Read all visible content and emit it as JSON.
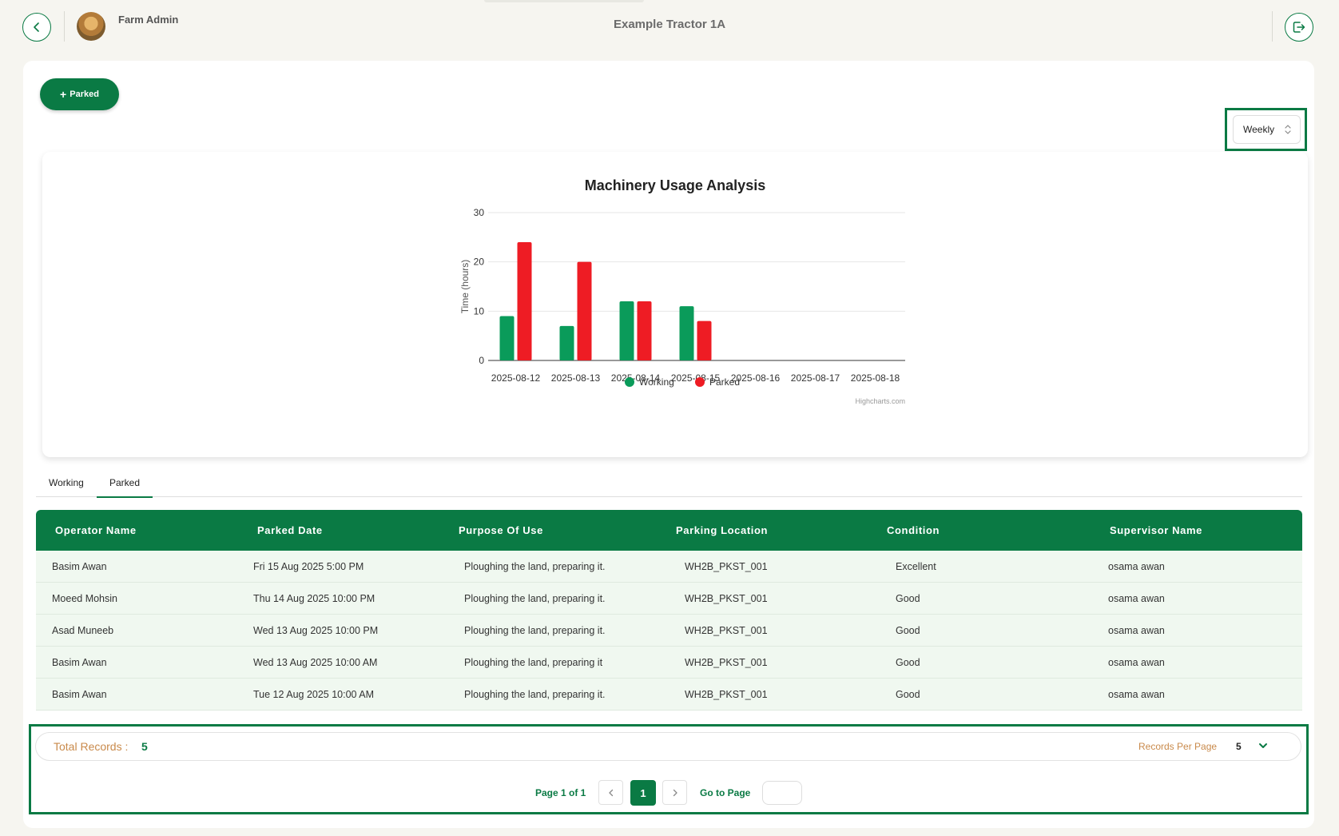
{
  "header": {
    "user_name": "Farm Admin",
    "page_title": "Example Tractor 1A"
  },
  "toolbar": {
    "add_label": "Parked",
    "period_value": "Weekly"
  },
  "chart_data": {
    "type": "bar",
    "title": "Machinery Usage Analysis",
    "ylabel": "Time (hours)",
    "xlabel": "",
    "ylim": [
      0,
      30
    ],
    "yticks": [
      0,
      10,
      20,
      30
    ],
    "categories": [
      "2025-08-12",
      "2025-08-13",
      "2025-08-14",
      "2025-08-15",
      "2025-08-16",
      "2025-08-17",
      "2025-08-18"
    ],
    "series": [
      {
        "name": "Working",
        "color": "#0a9b5a",
        "values": [
          9,
          7,
          12,
          11,
          0,
          0,
          0
        ]
      },
      {
        "name": "Parked",
        "color": "#ee1c24",
        "values": [
          24,
          20,
          12,
          8,
          0,
          0,
          0
        ]
      }
    ],
    "credit": "Highcharts.com",
    "grid": true,
    "legend_position": "bottom-center"
  },
  "tabs": [
    {
      "label": "Working",
      "active": false
    },
    {
      "label": "Parked",
      "active": true
    }
  ],
  "table": {
    "headers": [
      "Operator Name",
      "Parked Date",
      "Purpose Of Use",
      "Parking Location",
      "Condition",
      "Supervisor Name"
    ],
    "rows": [
      [
        "Basim Awan",
        "Fri 15 Aug 2025 5:00 PM",
        "Ploughing the land, preparing it.",
        "WH2B_PKST_001",
        "Excellent",
        "osama awan"
      ],
      [
        "Moeed Mohsin",
        "Thu 14 Aug 2025 10:00 PM",
        "Ploughing the land, preparing it.",
        "WH2B_PKST_001",
        "Good",
        "osama awan"
      ],
      [
        "Asad Muneeb",
        "Wed 13 Aug 2025 10:00 PM",
        "Ploughing the land, preparing it.",
        "WH2B_PKST_001",
        "Good",
        "osama awan"
      ],
      [
        "Basim Awan",
        "Wed 13 Aug 2025 10:00 AM",
        "Ploughing the land, preparing it",
        "WH2B_PKST_001",
        "Good",
        "osama awan"
      ],
      [
        "Basim Awan",
        "Tue 12 Aug 2025 10:00 AM",
        "Ploughing the land, preparing it.",
        "WH2B_PKST_001",
        "Good",
        "osama awan"
      ]
    ]
  },
  "footer": {
    "total_label": "Total Records :",
    "total_value": "5",
    "per_page_label": "Records Per Page",
    "per_page_value": "5",
    "page_info": "Page 1 of 1",
    "current_page": "1",
    "goto_label": "Go to Page"
  },
  "colors": {
    "brand": "#0a7a44",
    "accent_text": "#c98a4b",
    "working": "#0a9b5a",
    "parked": "#ee1c24"
  }
}
